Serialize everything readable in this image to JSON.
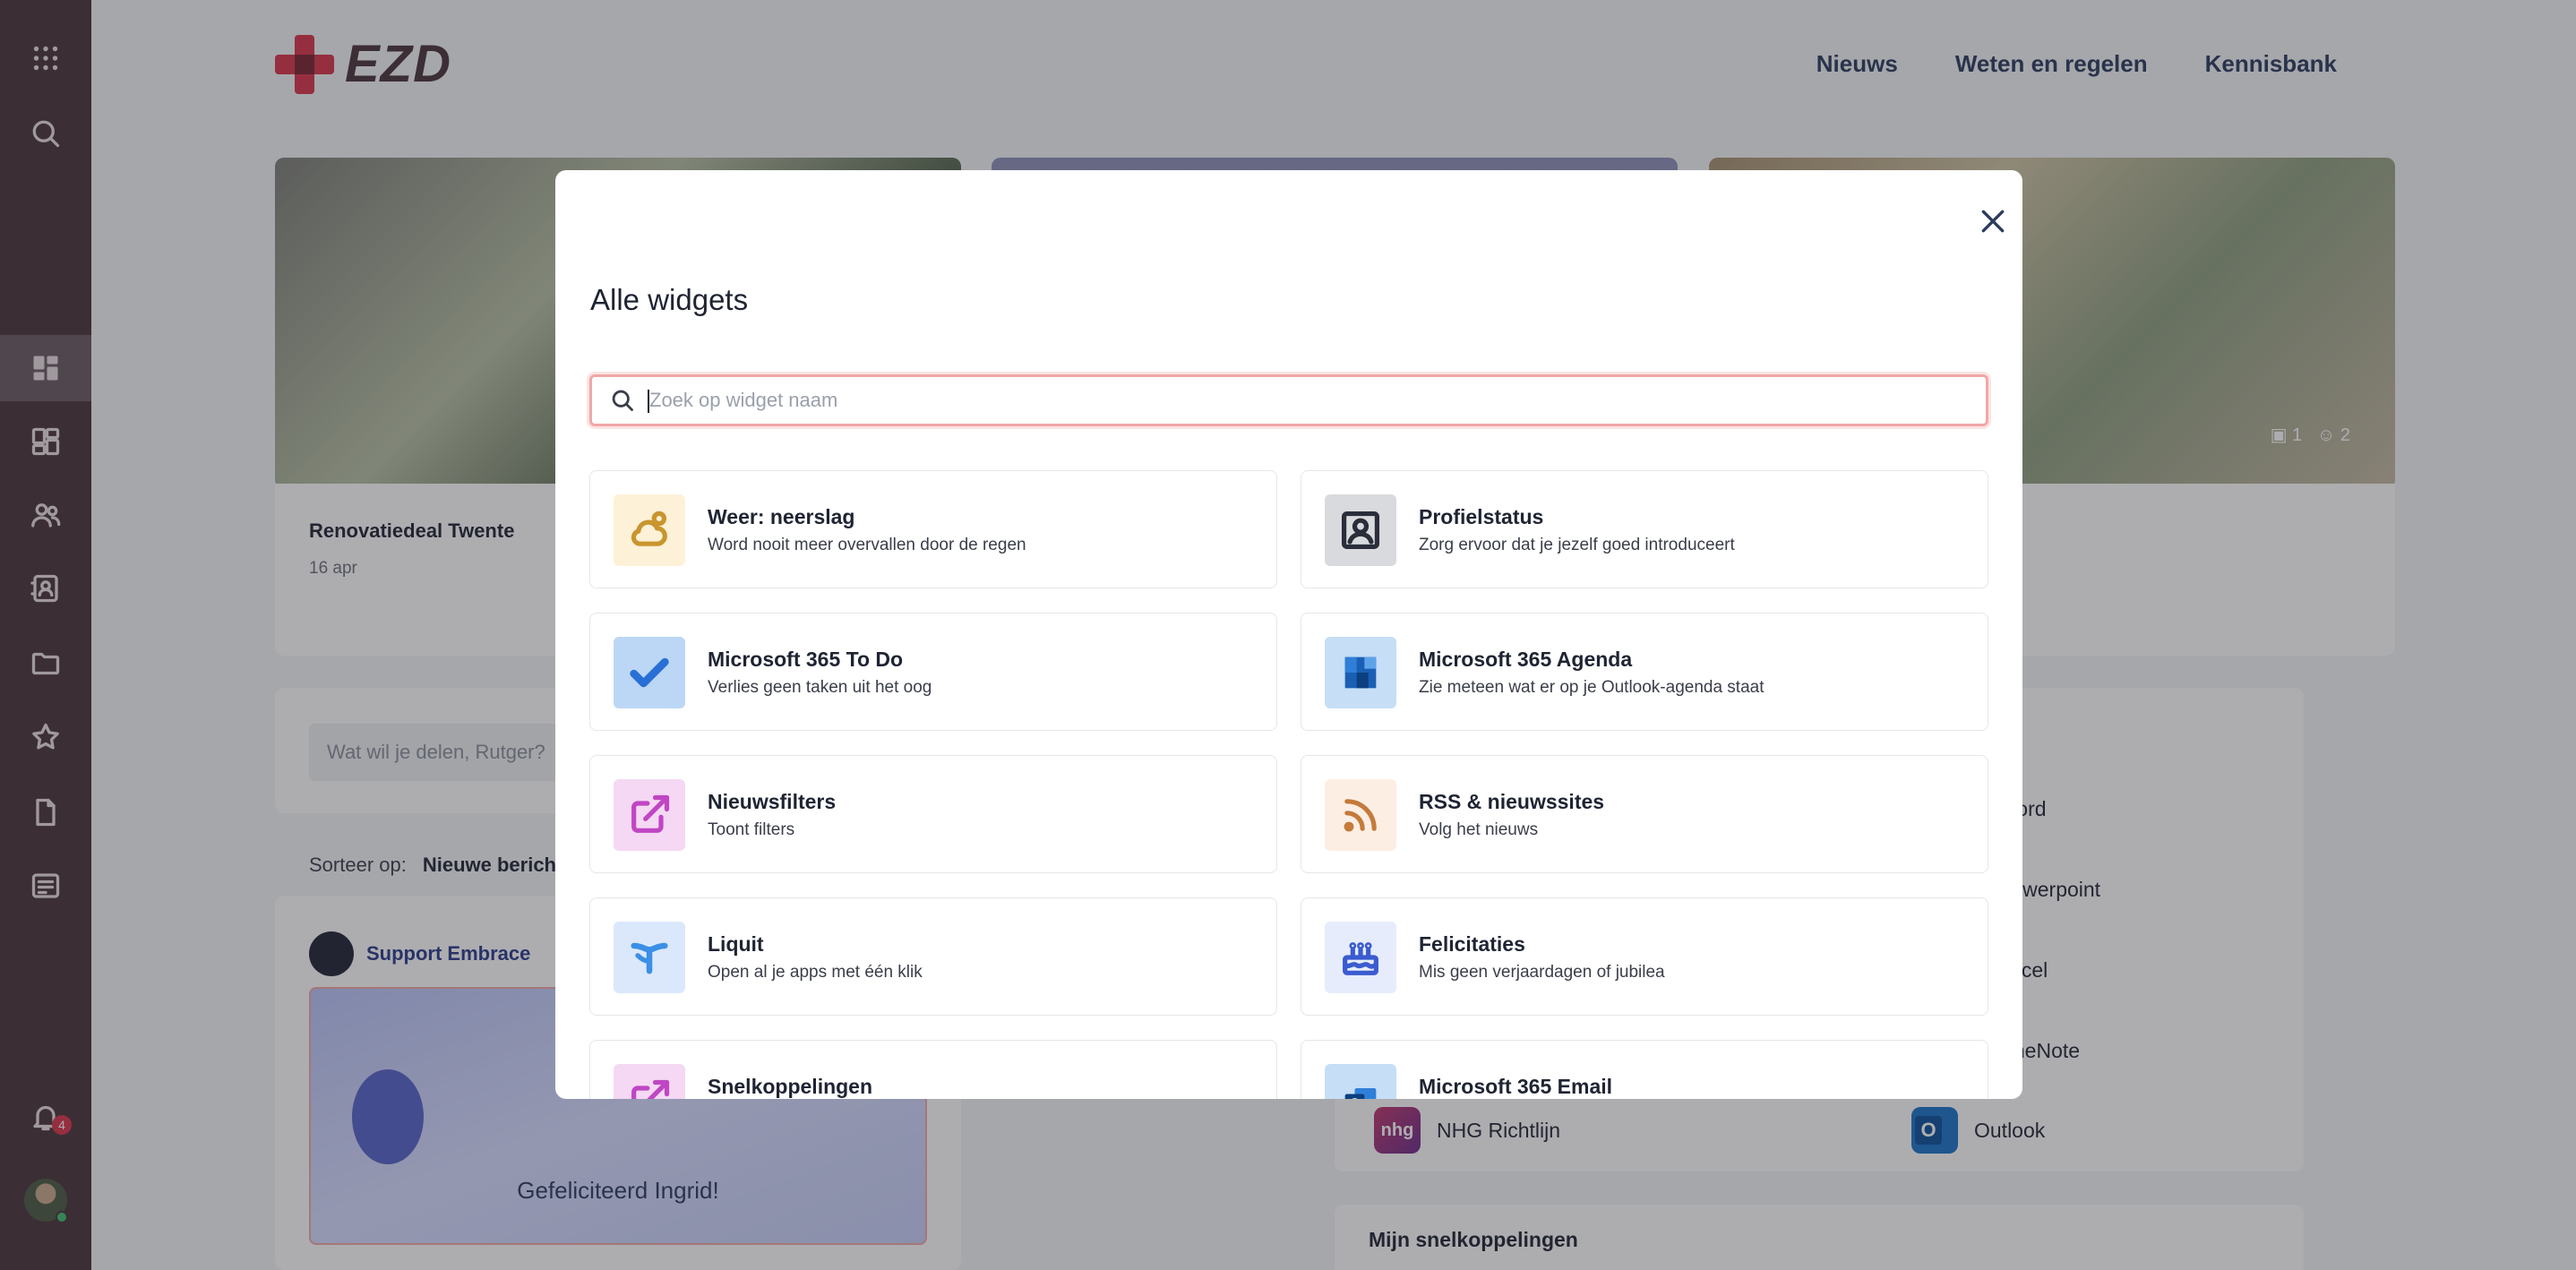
{
  "brand": {
    "name": "EZD",
    "accent": "#d9344a",
    "sidebar_color": "#4a3239"
  },
  "topnav": [
    "Nieuws",
    "Weten en regelen",
    "Kennisbank"
  ],
  "sidebar": {
    "icons": [
      "apps-grid-icon",
      "search-icon",
      "dashboard-icon",
      "widgets-icon",
      "people-icon",
      "contacts-icon",
      "folder-icon",
      "star-icon",
      "document-icon",
      "messages-icon",
      "bell-icon"
    ],
    "notification_count": "4"
  },
  "background": {
    "hero_meta": {
      "comments": "1",
      "reactions": "2"
    },
    "news": {
      "title": "Renovatiedeal Twente",
      "date": "16 apr"
    },
    "post_placeholder": "Wat wil je delen, Rutger?",
    "sort_label": "Sorteer op:",
    "sort_value": "Nieuwe berichten",
    "feed_author": "Support Embrace",
    "feed_congrats": "Gefeliciteerd Ingrid!",
    "apps": [
      "Word",
      "Powerpoint",
      "Excel",
      "OneNote"
    ],
    "nhg_label": "NHG Richtlijn",
    "nhg_logo_text": "nhg",
    "outlook_label": "Outlook",
    "shortcuts_title": "Mijn snelkoppelingen"
  },
  "modal": {
    "title": "Alle widgets",
    "search_placeholder": "Zoek op widget naam",
    "widgets": [
      {
        "title": "Weer: neerslag",
        "desc": "Word nooit meer overvallen door de regen",
        "icon": "weather-icon",
        "bg": "#fdf1d8",
        "color": "#c9952f"
      },
      {
        "title": "Profielstatus",
        "desc": "Zorg ervoor dat je jezelf goed introduceert",
        "icon": "profile-icon",
        "bg": "#d9dadd",
        "color": "#2a2e3a"
      },
      {
        "title": "Microsoft 365 To Do",
        "desc": "Verlies geen taken uit het oog",
        "icon": "todo-icon",
        "bg": "#bcd7f5",
        "color": "#2a6fd6"
      },
      {
        "title": "Microsoft 365 Agenda",
        "desc": "Zie meteen wat er op je Outlook-agenda staat",
        "icon": "calendar-icon",
        "bg": "#c6def6",
        "color": "#1a5fb4"
      },
      {
        "title": "Nieuwsfilters",
        "desc": "Toont filters",
        "icon": "external-link-icon",
        "bg": "#f5d8f3",
        "color": "#c046c4"
      },
      {
        "title": "RSS & nieuwssites",
        "desc": "Volg het nieuws",
        "icon": "rss-icon",
        "bg": "#fdeee4",
        "color": "#c47a3a"
      },
      {
        "title": "Liquit",
        "desc": "Open al je apps met één klik",
        "icon": "liquit-icon",
        "bg": "#dbe8fb",
        "color": "#3b8fe6"
      },
      {
        "title": "Felicitaties",
        "desc": "Mis geen verjaardagen of jubilea",
        "icon": "cake-icon",
        "bg": "#e6ecfb",
        "color": "#3b5bd0"
      },
      {
        "title": "Snelkoppelingen",
        "desc": "",
        "icon": "external-link-icon",
        "bg": "#f5d8f3",
        "color": "#c046c4"
      },
      {
        "title": "Microsoft 365 Email",
        "desc": "",
        "icon": "email-icon",
        "bg": "#c6def6",
        "color": "#1a5fb4"
      }
    ]
  }
}
